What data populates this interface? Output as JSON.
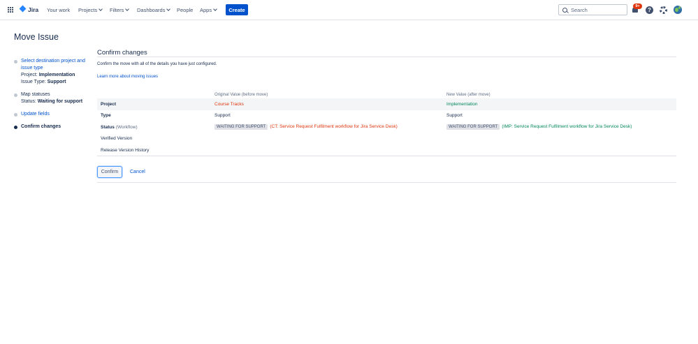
{
  "nav": {
    "logo": "Jira",
    "items": [
      {
        "label": "Your work",
        "has_dropdown": false
      },
      {
        "label": "Projects",
        "has_dropdown": true
      },
      {
        "label": "Filters",
        "has_dropdown": true
      },
      {
        "label": "Dashboards",
        "has_dropdown": true
      },
      {
        "label": "People",
        "has_dropdown": false
      },
      {
        "label": "Apps",
        "has_dropdown": true
      }
    ],
    "create_label": "Create",
    "search_placeholder": "Search",
    "notification_badge": "9+",
    "help_glyph": "?"
  },
  "page": {
    "title": "Move Issue"
  },
  "steps": {
    "step1": {
      "link": "Select destination project and issue type",
      "project_label": "Project:",
      "project_value": "Implementation",
      "type_label": "Issue Type:",
      "type_value": "Support"
    },
    "step2": {
      "label": "Map statuses",
      "status_label": "Status:",
      "status_value": "Waiting for support"
    },
    "step3": {
      "link": "Update fields"
    },
    "step4": {
      "label": "Confirm changes"
    }
  },
  "main": {
    "section_title": "Confirm changes",
    "description": "Confirm the move with all of the details you have just configured.",
    "learn_more": "Learn more about moving issues",
    "columns": {
      "original": "Original Value (before move)",
      "new": "New Value (after move)"
    },
    "rows": {
      "project": {
        "label": "Project",
        "old": "Course Tracks",
        "new": "Implementation"
      },
      "type": {
        "label": "Type",
        "old": "Support",
        "new": "Support"
      },
      "status": {
        "label": "Status",
        "suffix": "(Workflow)",
        "old_status": "WAITING FOR SUPPORT",
        "old_workflow": "(CT: Service Request Fulfilment workflow for Jira Service Desk)",
        "new_status": "WAITING FOR SUPPORT",
        "new_workflow": "(IMP: Service Request Fulfilment workflow for Jira Service Desk)"
      },
      "verified": {
        "label": "Verified Version"
      },
      "release": {
        "label": "Release Version History"
      }
    },
    "confirm_label": "Confirm",
    "cancel_label": "Cancel"
  },
  "colors": {
    "brand": "#0052cc",
    "old_value": "#de350b",
    "new_value": "#00875a"
  }
}
